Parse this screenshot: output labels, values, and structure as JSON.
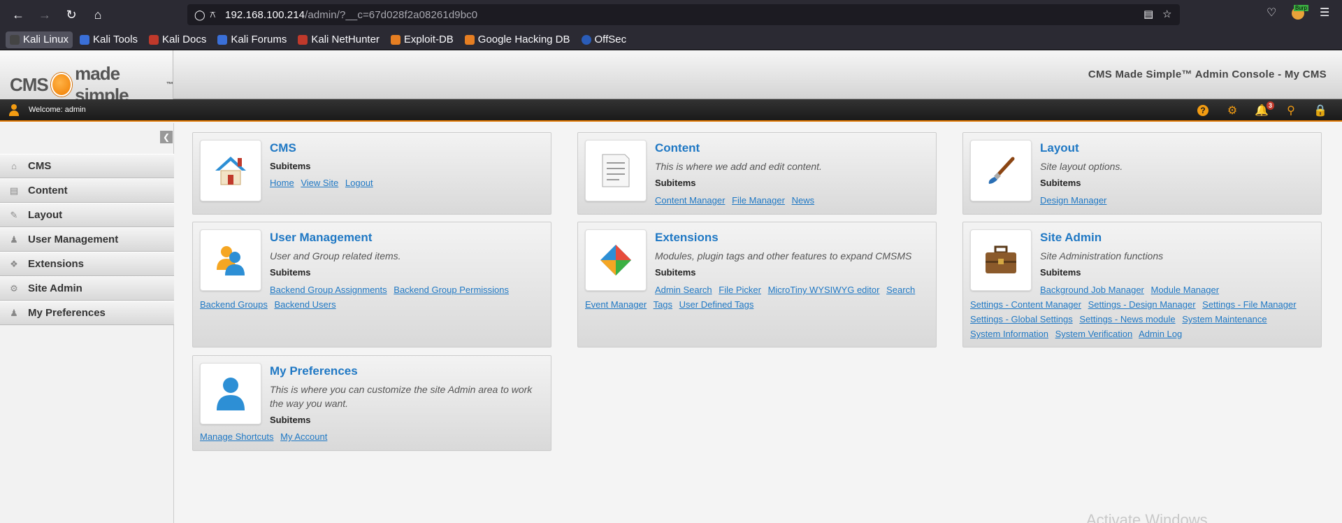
{
  "browser": {
    "url_host": "192.168.100.214",
    "url_path": "/admin/?__c=67d028f2a08261d9bc0",
    "burp_label": "Burp"
  },
  "bookmarks": [
    {
      "label": "Kali Linux",
      "color": "#2b2a33"
    },
    {
      "label": "Kali Tools",
      "color": "#3a6fd8"
    },
    {
      "label": "Kali Docs",
      "color": "#c0392b"
    },
    {
      "label": "Kali Forums",
      "color": "#3a6fd8"
    },
    {
      "label": "Kali NetHunter",
      "color": "#c0392b"
    },
    {
      "label": "Exploit-DB",
      "color": "#e67e22"
    },
    {
      "label": "Google Hacking DB",
      "color": "#e67e22"
    },
    {
      "label": "OffSec",
      "color": "#2a5cb8"
    }
  ],
  "header": {
    "logo_left": "CMS",
    "logo_right": "made simple",
    "logo_tm": "™",
    "title": "CMS Made Simple™ Admin Console - My CMS"
  },
  "userbar": {
    "welcome": "Welcome: admin",
    "notifications": "3"
  },
  "sidebar": {
    "items": [
      {
        "label": "CMS",
        "icon": "house-icon"
      },
      {
        "label": "Content",
        "icon": "page-icon"
      },
      {
        "label": "Layout",
        "icon": "layout-icon"
      },
      {
        "label": "User Management",
        "icon": "users-icon"
      },
      {
        "label": "Extensions",
        "icon": "puzzle-icon"
      },
      {
        "label": "Site Admin",
        "icon": "gear-icon"
      },
      {
        "label": "My Preferences",
        "icon": "user-icon"
      }
    ]
  },
  "panels": {
    "cms": {
      "title": "CMS",
      "subitems": "Subitems",
      "links": [
        "Home",
        "View Site",
        "Logout"
      ]
    },
    "content": {
      "title": "Content",
      "desc": "This is where we add and edit content.",
      "subitems": "Subitems",
      "links": [
        "Content Manager",
        "File Manager",
        "News"
      ]
    },
    "layout": {
      "title": "Layout",
      "desc": "Site layout options.",
      "subitems": "Subitems",
      "links": [
        "Design Manager"
      ]
    },
    "usermgmt": {
      "title": "User Management",
      "desc": "User and Group related items.",
      "subitems": "Subitems",
      "links": [
        "Backend Group Assignments",
        "Backend Group Permissions",
        "Backend Groups",
        "Backend Users"
      ]
    },
    "extensions": {
      "title": "Extensions",
      "desc": "Modules, plugin tags and other features to expand CMSMS",
      "subitems": "Subitems",
      "links": [
        "Admin Search",
        "File Picker",
        "MicroTiny WYSIWYG editor",
        "Search",
        "Event Manager",
        "Tags",
        "User Defined Tags"
      ]
    },
    "siteadmin": {
      "title": "Site Admin",
      "desc": "Site Administration functions",
      "subitems": "Subitems",
      "links": [
        "Background Job Manager",
        "Module Manager",
        "Settings - Content Manager",
        "Settings - Design Manager",
        "Settings - File Manager",
        "Settings - Global Settings",
        "Settings - News module",
        "System Maintenance",
        "System Information",
        "System Verification",
        "Admin Log"
      ]
    },
    "prefs": {
      "title": "My Preferences",
      "desc": "This is where you can customize the site Admin area to work the way you want.",
      "subitems": "Subitems",
      "links": [
        "Manage Shortcuts",
        "My Account"
      ]
    }
  },
  "watermark": "Activate Windows"
}
